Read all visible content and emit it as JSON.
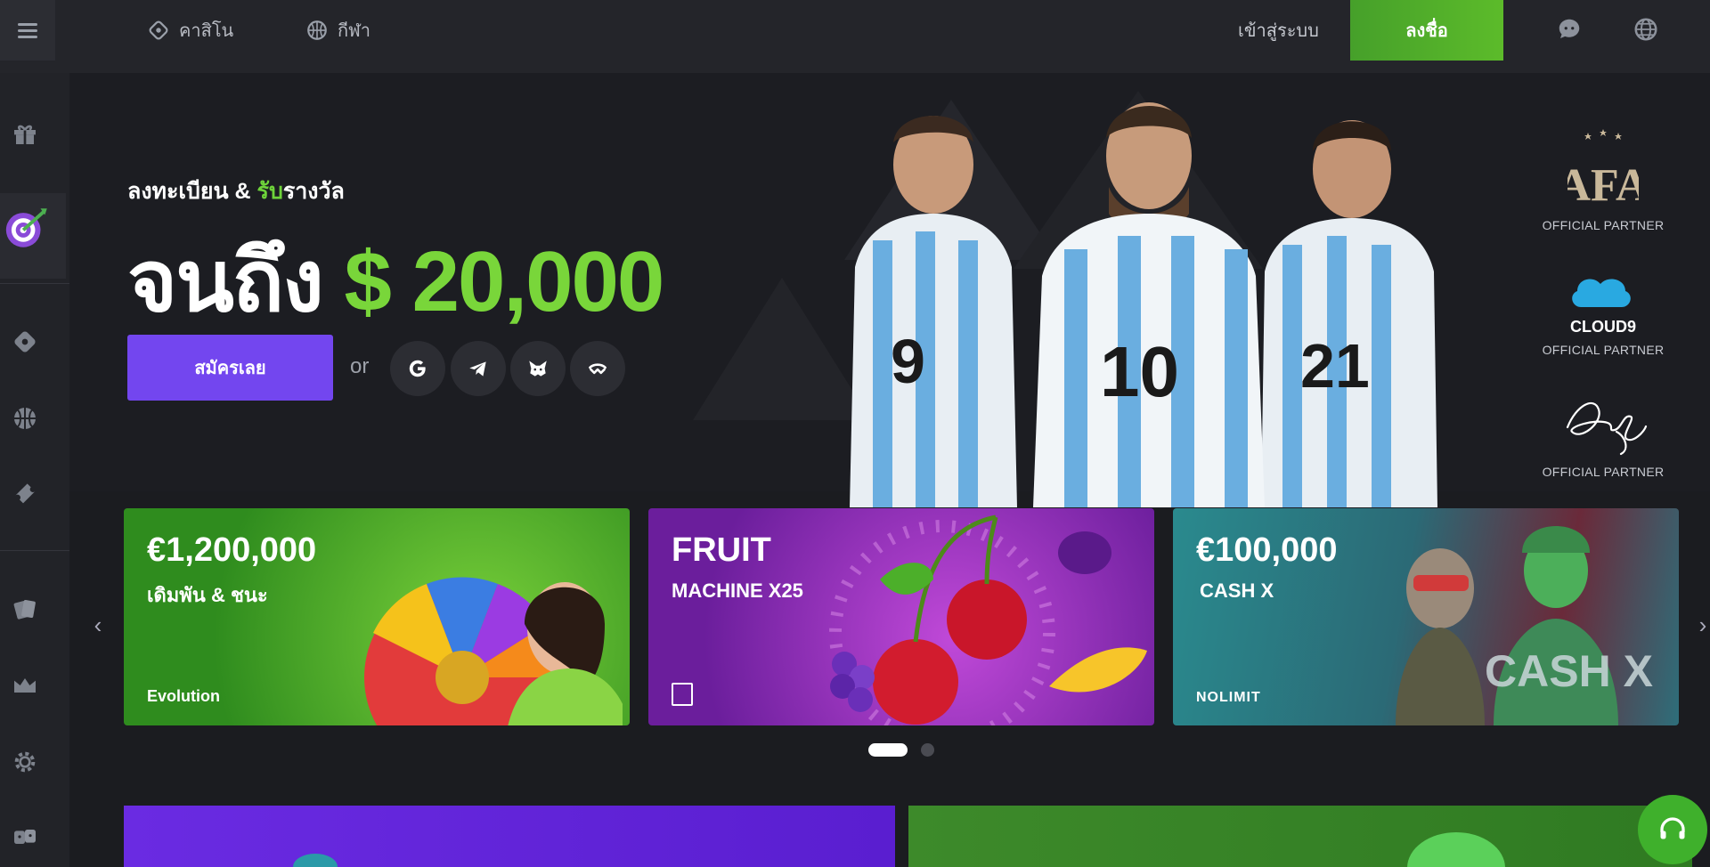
{
  "nav": {
    "casino_label": "คาสิโน",
    "sports_label": "กีฬา",
    "login_label": "เข้าสู่ระบบ",
    "signup_label": "ลงชื่อ"
  },
  "hero": {
    "subtitle_prefix": "ลงทะเบียน & ",
    "subtitle_highlight": "รับ",
    "subtitle_suffix": "รางวัล",
    "big_prefix": "จนถึง ",
    "big_amount": "$ 20,000",
    "cta_label": "สมัครเลย",
    "or_label": "or",
    "social_icons": [
      "google-icon",
      "telegram-icon",
      "metamask-icon",
      "walletconnect-icon"
    ]
  },
  "partners": [
    {
      "logo_text": "AFA",
      "label": "OFFICIAL PARTNER"
    },
    {
      "logo_text": "CLOUD9",
      "label": "OFFICIAL PARTNER"
    },
    {
      "logo_text": "Dybala",
      "label": "OFFICIAL PARTNER"
    }
  ],
  "cards": [
    {
      "title": "€1,200,000",
      "subtitle": "เดิมพัน & ชนะ",
      "brand": "Evolution",
      "color": "#3e9a22"
    },
    {
      "title": "FRUIT",
      "subtitle": "MACHINE X25",
      "brand": "",
      "color": "#8a2bb8"
    },
    {
      "title": "€100,000",
      "subtitle": "CASH X",
      "brand": "NOLIMIT",
      "color": "#1f6a78"
    }
  ],
  "players": [
    "9",
    "10",
    "21"
  ],
  "colors": {
    "accent_green": "#5cbb2a",
    "accent_purple": "#7346ef",
    "background": "#1b1c20"
  }
}
